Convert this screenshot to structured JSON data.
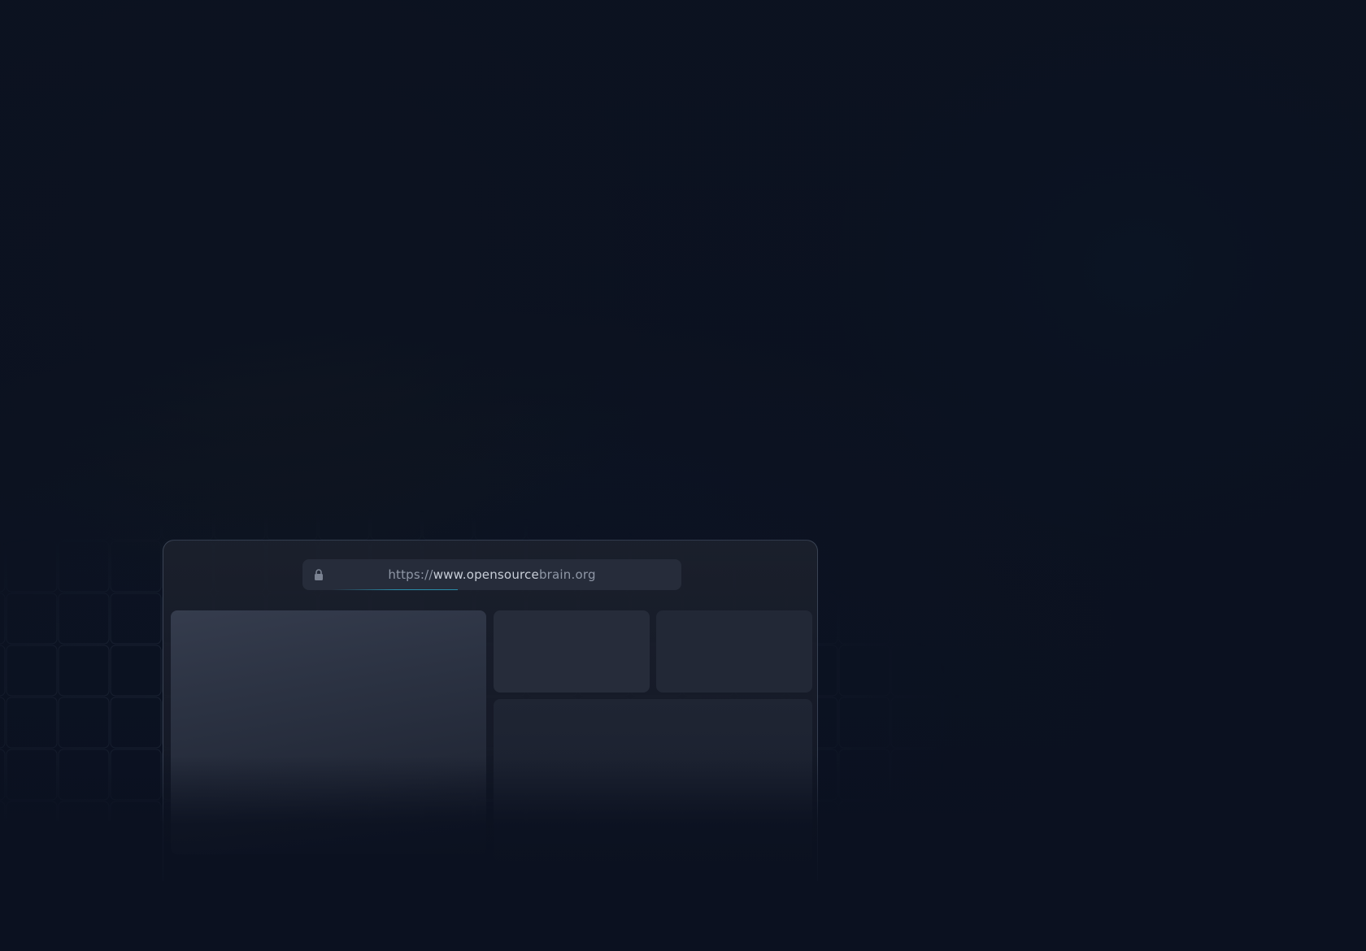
{
  "browser": {
    "url_bar": {
      "protocol": "https://",
      "subdomain": "www.",
      "domain": "opensource",
      "domain_rest": "brain",
      "tld": ".org"
    }
  },
  "icons": {
    "lock": "lock-icon"
  },
  "colors": {
    "background": "#0b1120",
    "accent_glow": "#083448",
    "url_underline": "#2896b4"
  }
}
